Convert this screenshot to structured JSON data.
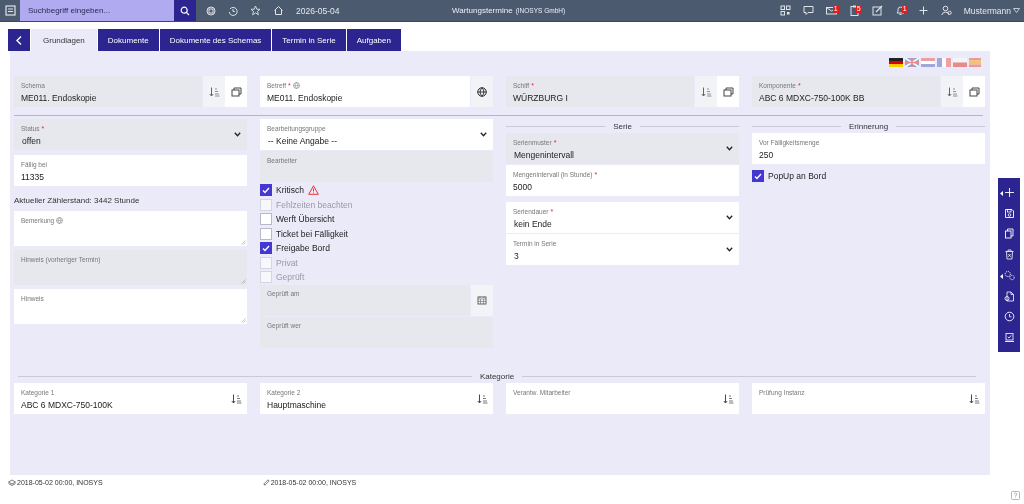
{
  "topbar": {
    "search_placeholder": "Suchbegriff eingeben...",
    "date": "2026-05-04",
    "title": "Wartungstermine",
    "company": "(INOSYS GmbH)",
    "user": "Mustermann",
    "icons": [
      {
        "kind": "qr"
      },
      {
        "kind": "chat"
      },
      {
        "kind": "mail",
        "badge": "1"
      },
      {
        "kind": "clipboard",
        "badge": "5"
      },
      {
        "kind": "edit"
      },
      {
        "kind": "bell",
        "badge": "1"
      },
      {
        "kind": "plus"
      },
      {
        "kind": "user"
      }
    ]
  },
  "tabs": [
    {
      "label": "Grundlagen",
      "selected": true
    },
    {
      "label": "Dokumente",
      "selected": false
    },
    {
      "label": "Dokumente des Schemas",
      "selected": false
    },
    {
      "label": "Termin in Serie",
      "selected": false
    },
    {
      "label": "Aufgaben",
      "selected": false
    }
  ],
  "main_fields": [
    {
      "label": "Schema",
      "value": "ME011. Endoskopie",
      "readonly": true,
      "buttons": [
        {
          "kind": "sort"
        },
        {
          "kind": "open"
        }
      ]
    },
    {
      "label": "Betreff",
      "required": "*",
      "globe": true,
      "value": "ME011. Endoskopie",
      "readonly": false,
      "buttons": [
        {
          "kind": "globe"
        }
      ]
    },
    {
      "label": "Schiff",
      "required": "*",
      "value": "WÜRZBURG I",
      "readonly": true,
      "buttons": [
        {
          "kind": "sort"
        },
        {
          "kind": "open"
        }
      ]
    },
    {
      "label": "Komponente",
      "required": "*",
      "value": "ABC 6 MDXC-750-100K BB",
      "readonly": true,
      "buttons": [
        {
          "kind": "sort"
        },
        {
          "kind": "open"
        }
      ]
    }
  ],
  "columns": [
    {
      "items": [
        {
          "kind": "select",
          "label": "Status",
          "required": "*",
          "value": "offen",
          "readonly": true
        },
        {
          "kind": "text",
          "label": "Fällig bei",
          "value": "11335",
          "readonly": false
        },
        {
          "kind": "info",
          "text": "Aktueller Zählerstand: 3442 Stunde"
        },
        {
          "kind": "textarea",
          "label": "Bemerkung",
          "globe": true,
          "readonly": false
        },
        {
          "kind": "textarea",
          "label": "Hinweis (vorheriger Termin)",
          "readonly": true
        },
        {
          "kind": "textarea",
          "label": "Hinweis",
          "readonly": false
        }
      ]
    },
    {
      "items": [
        {
          "kind": "select",
          "label": "Bearbeitungsgruppe",
          "value": "-- Keine Angabe --",
          "readonly": false
        },
        {
          "kind": "text",
          "label": "Bearbeiter",
          "readonly": true
        },
        {
          "kind": "checkbox",
          "label": "Kritisch",
          "checked": true,
          "disabled": false,
          "warning": true
        },
        {
          "kind": "checkbox",
          "label": "Fehlzeiten beachten",
          "checked": false,
          "disabled": true
        },
        {
          "kind": "checkbox",
          "label": "Werft Übersicht",
          "checked": false,
          "disabled": false
        },
        {
          "kind": "checkbox",
          "label": "Ticket bei Fälligkeit",
          "checked": false,
          "disabled": false
        },
        {
          "kind": "checkbox",
          "label": "Freigabe Bord",
          "checked": true,
          "disabled": false
        },
        {
          "kind": "checkbox",
          "label": "Privat",
          "checked": false,
          "disabled": true
        },
        {
          "kind": "checkbox",
          "label": "Geprüft",
          "checked": false,
          "disabled": true
        },
        {
          "kind": "date",
          "label": "Geprüft am",
          "readonly": true,
          "buttons": [
            {
              "kind": "calendar"
            }
          ]
        },
        {
          "kind": "text",
          "label": "Geprüft wer",
          "readonly": true
        }
      ]
    },
    {
      "heading": "Serie",
      "items": [
        {
          "kind": "select",
          "label": "Serienmuster",
          "required": "*",
          "value": "Mengenintervall",
          "readonly": true
        },
        {
          "kind": "text",
          "label": "Mengenintervall (in Stunde)",
          "required": "*",
          "value": "5000",
          "readonly": false
        },
        {
          "kind": "select",
          "label": "Seriendauer",
          "required": "*",
          "value": "kein Ende",
          "readonly": false
        },
        {
          "kind": "select",
          "label": "Termin in Serie",
          "value": "3",
          "readonly": false
        }
      ]
    },
    {
      "heading": "Erinnerung",
      "items": [
        {
          "kind": "text",
          "label": "Vor Fälligkeitsmenge",
          "value": "250",
          "readonly": false
        },
        {
          "kind": "checkbox",
          "label": "PopUp an Bord",
          "checked": true,
          "disabled": false
        }
      ]
    }
  ],
  "kategorie": {
    "heading": "Kategorie",
    "fields": [
      {
        "label": "Kategorie 1",
        "value": "ABC 6 MDXC-750-100K",
        "readonly": false,
        "buttons": [
          {
            "kind": "sort"
          }
        ]
      },
      {
        "label": "Kategorie 2",
        "value": "Hauptmaschine",
        "readonly": false,
        "buttons": [
          {
            "kind": "sort"
          }
        ]
      },
      {
        "label": "Verantw. Mitarbeiter",
        "readonly": false,
        "buttons": [
          {
            "kind": "sort"
          }
        ]
      },
      {
        "label": "Prüfung Instanz",
        "readonly": false,
        "buttons": [
          {
            "kind": "sort"
          }
        ]
      }
    ]
  },
  "footer": {
    "created": "2018-05-02 00:00, INOSYS",
    "modified": "2018-05-02 00:00, INOSYS"
  },
  "side_actions": [
    {
      "kind": "add",
      "expand": true
    },
    {
      "kind": "save"
    },
    {
      "kind": "copy"
    },
    {
      "kind": "delete"
    },
    {
      "kind": "gears",
      "expand": true
    },
    {
      "kind": "document"
    },
    {
      "kind": "clock"
    },
    {
      "kind": "approve"
    }
  ]
}
